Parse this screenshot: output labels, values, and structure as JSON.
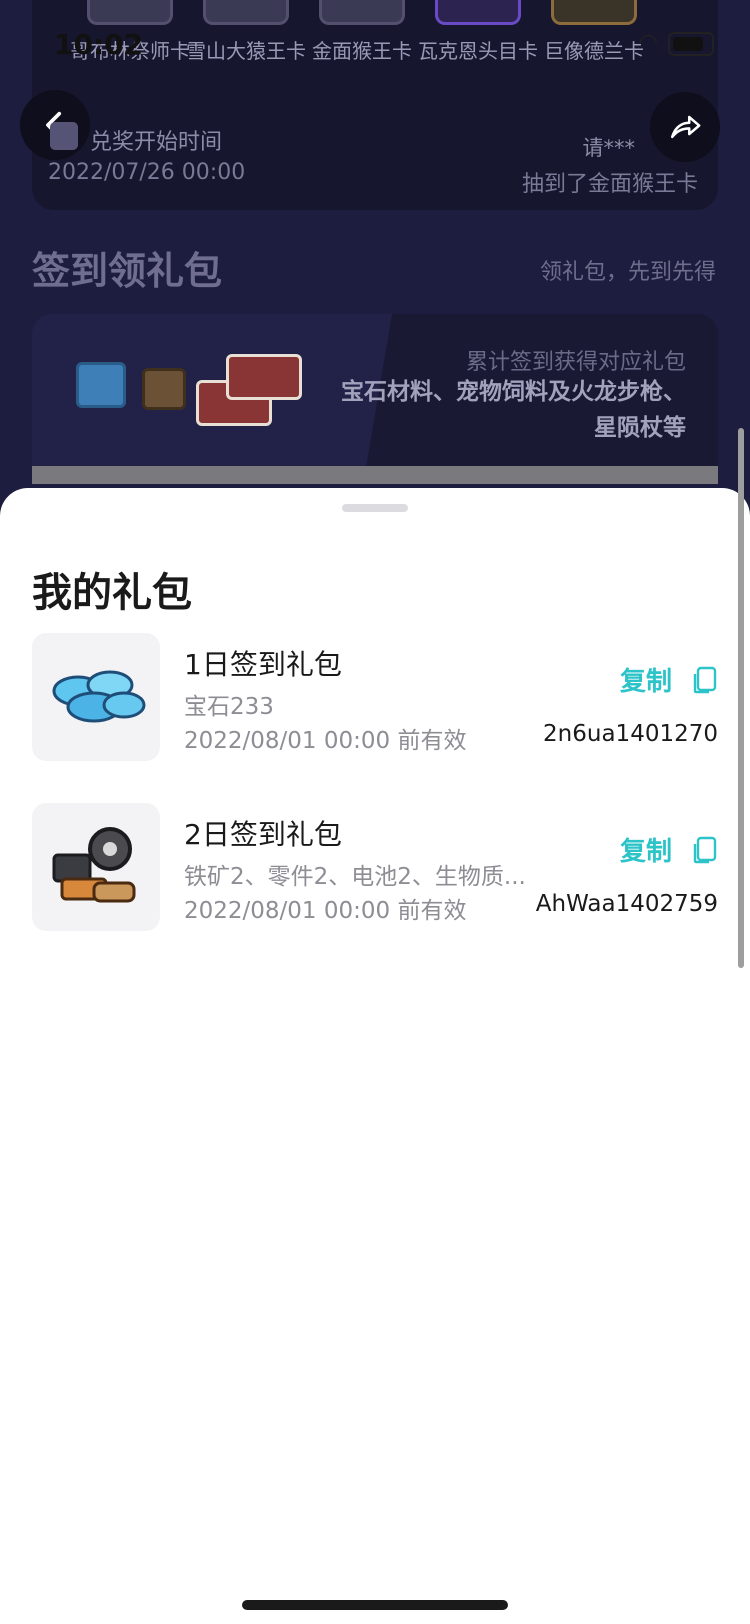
{
  "status_bar": {
    "time": "10:02"
  },
  "cards": [
    {
      "name": "哥布林祭师卡"
    },
    {
      "name": "雪山大猿王卡"
    },
    {
      "name": "金面猴王卡"
    },
    {
      "name": "瓦克恩头目卡"
    },
    {
      "name": "巨像德兰卡"
    }
  ],
  "redeem": {
    "label": "兑奖开始时间",
    "time": "2022/07/26 00:00",
    "winner_user": "请***",
    "winner_text": "抽到了金面猴王卡"
  },
  "signin": {
    "title": "签到领礼包",
    "subtitle": "领礼包，先到先得",
    "banner_line1": "累计签到获得对应礼包",
    "banner_line2": "宝石材料、宠物饲料及火龙步枪、星陨杖等"
  },
  "sheet": {
    "title": "我的礼包",
    "packs": [
      {
        "name": "1日签到礼包",
        "desc": "宝石233",
        "valid": "2022/08/01 00:00 前有效",
        "copy_label": "复制",
        "code": "2n6ua1401270"
      },
      {
        "name": "2日签到礼包",
        "desc": "铁矿2、零件2、电池2、生物质...",
        "valid": "2022/08/01 00:00 前有效",
        "copy_label": "复制",
        "code": "AhWaa1402759"
      }
    ]
  },
  "colors": {
    "accent": "#2cc3c9",
    "background_dark": "#1d1d3f"
  }
}
